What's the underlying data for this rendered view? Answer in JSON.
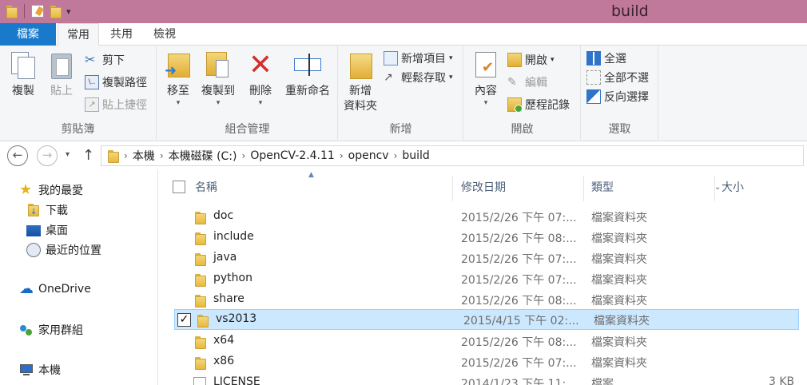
{
  "window": {
    "title": "build"
  },
  "tabs": {
    "file": "檔案",
    "home": "常用",
    "share": "共用",
    "view": "檢視"
  },
  "ribbon": {
    "clipboard": {
      "label": "剪貼簿",
      "copy": "複製",
      "paste": "貼上",
      "cut": "剪下",
      "copy_path": "複製路徑",
      "paste_shortcut": "貼上捷徑"
    },
    "organize": {
      "label": "組合管理",
      "move_to": "移至",
      "copy_to": "複製到",
      "delete": "刪除",
      "rename": "重新命名"
    },
    "new": {
      "label": "新增",
      "new_folder_line1": "新增",
      "new_folder_line2": "資料夾",
      "new_item": "新增項目",
      "easy_access": "輕鬆存取"
    },
    "open": {
      "label": "開啟",
      "properties": "內容",
      "open": "開啟",
      "edit": "編輯",
      "history": "歷程記錄"
    },
    "select": {
      "label": "選取",
      "select_all": "全選",
      "select_none": "全部不選",
      "invert": "反向選擇"
    }
  },
  "address": {
    "crumbs": [
      "本機",
      "本機磁碟 (C:)",
      "OpenCV-2.4.11",
      "opencv",
      "build"
    ]
  },
  "nav": {
    "favorites": "我的最愛",
    "downloads": "下載",
    "desktop": "桌面",
    "recent": "最近的位置",
    "onedrive": "OneDrive",
    "homegroup": "家用群組",
    "thispc": "本機"
  },
  "columns": {
    "name": "名稱",
    "date": "修改日期",
    "type": "類型",
    "size": "大小"
  },
  "files": [
    {
      "name": "doc",
      "date": "2015/2/26 下午 07:...",
      "type": "檔案資料夾",
      "size": ""
    },
    {
      "name": "include",
      "date": "2015/2/26 下午 08:...",
      "type": "檔案資料夾",
      "size": ""
    },
    {
      "name": "java",
      "date": "2015/2/26 下午 07:...",
      "type": "檔案資料夾",
      "size": ""
    },
    {
      "name": "python",
      "date": "2015/2/26 下午 07:...",
      "type": "檔案資料夾",
      "size": ""
    },
    {
      "name": "share",
      "date": "2015/2/26 下午 08:...",
      "type": "檔案資料夾",
      "size": ""
    },
    {
      "name": "vs2013",
      "date": "2015/4/15 下午 02:...",
      "type": "檔案資料夾",
      "size": "",
      "selected": true
    },
    {
      "name": "x64",
      "date": "2015/2/26 下午 08:...",
      "type": "檔案資料夾",
      "size": ""
    },
    {
      "name": "x86",
      "date": "2015/2/26 下午 07:...",
      "type": "檔案資料夾",
      "size": ""
    },
    {
      "name": "LICENSE",
      "date": "2014/1/23 下午 11:...",
      "type": "檔案",
      "size": "3 KB"
    }
  ],
  "colors": {
    "titlebar": "#c0789b",
    "file_tab": "#1979ca",
    "selection": "#cce8ff"
  }
}
